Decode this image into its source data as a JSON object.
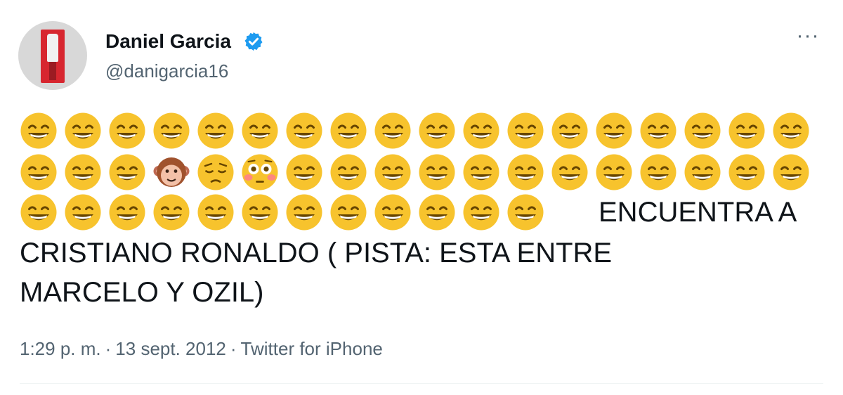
{
  "author": {
    "name": "Daniel Garcia",
    "handle": "@danigarcia16",
    "verified": true
  },
  "menu_icon": "more-horizontal-icon",
  "tweet": {
    "emoji_rows": [
      [
        "grinning",
        "grinning",
        "grinning",
        "grinning",
        "grinning",
        "grinning",
        "grinning",
        "grinning",
        "grinning",
        "grinning",
        "grinning",
        "grinning",
        "grinning",
        "grinning",
        "grinning",
        "grinning",
        "grinning",
        "grinning"
      ],
      [
        "grinning",
        "grinning",
        "grinning",
        "monkey-face",
        "pensive",
        "flushed",
        "grinning",
        "grinning",
        "grinning",
        "grinning",
        "grinning",
        "grinning",
        "grinning",
        "grinning",
        "grinning",
        "grinning",
        "grinning",
        "grinning"
      ],
      [
        "grinning",
        "grinning",
        "grinning",
        "grinning",
        "grinning",
        "grinning",
        "grinning",
        "grinning",
        "grinning",
        "grinning",
        "grinning",
        "grinning"
      ]
    ],
    "text_part1": "ENCUENTRA A",
    "text_line2": "CRISTIANO RONALDO  ( PISTA: ESTA ENTRE",
    "text_line3": "MARCELO Y OZIL)"
  },
  "meta": {
    "time": "1:29 p. m.",
    "separator": "·",
    "date": "13 sept. 2012",
    "source": "Twitter for iPhone"
  },
  "colors": {
    "text": "#0f1419",
    "secondary": "#536471",
    "verified": "#1d9bf0",
    "emoji_face": "#f7c32d",
    "divider": "#eff3f4"
  }
}
